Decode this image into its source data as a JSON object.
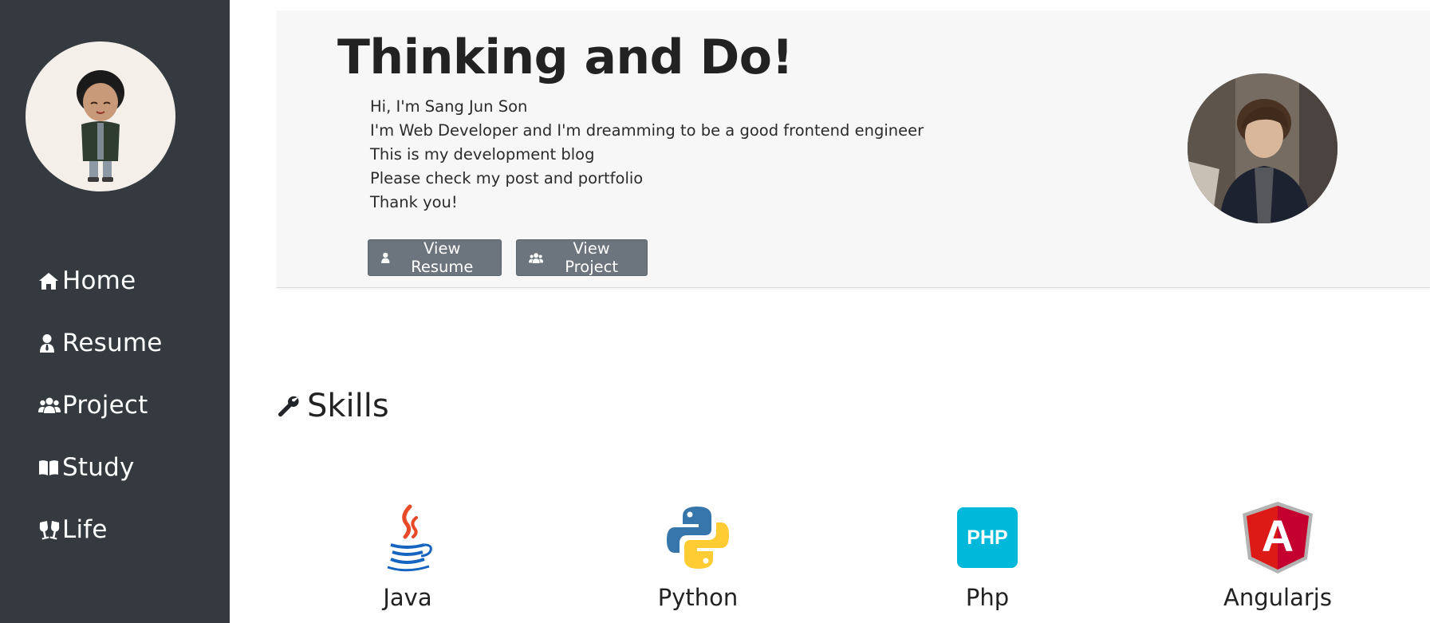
{
  "sidebar": {
    "nav": [
      {
        "label": "Home",
        "icon": "home-icon"
      },
      {
        "label": "Resume",
        "icon": "user-tie-icon"
      },
      {
        "label": "Project",
        "icon": "users-icon"
      },
      {
        "label": "Study",
        "icon": "book-open-icon"
      },
      {
        "label": "Life",
        "icon": "glass-cheers-icon"
      }
    ]
  },
  "hero": {
    "title": "Thinking and Do!",
    "lines": [
      "Hi, I'm Sang Jun Son",
      "I'm Web Developer and I'm dreamming to be a good frontend engineer",
      "This is my development blog",
      "Please check my post and portfolio",
      "Thank you!"
    ],
    "buttons": {
      "resume": "View Resume",
      "project": "View Project"
    }
  },
  "skills": {
    "title": "Skills",
    "items": [
      {
        "name": "Java",
        "icon": "java-logo-icon"
      },
      {
        "name": "Python",
        "icon": "python-logo-icon"
      },
      {
        "name": "Php",
        "icon": "php-logo-icon",
        "badge": "PHP"
      },
      {
        "name": "Angularjs",
        "icon": "angular-logo-icon",
        "badge": "A"
      }
    ]
  },
  "colors": {
    "sidebar_bg": "#343a40",
    "hero_bg": "#f7f7f7",
    "button_bg": "#6c757d",
    "php_blue": "#00b8d9",
    "angular_red": "#dd1b16"
  }
}
